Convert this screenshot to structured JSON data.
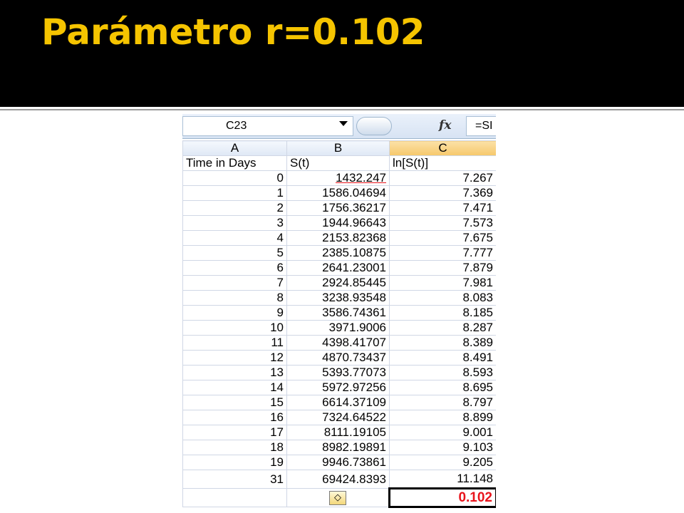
{
  "slide": {
    "title": "Parámetro r=0.102"
  },
  "formula_bar": {
    "name_box": "C23",
    "fx_label": "fx",
    "formula_text": "=SI"
  },
  "columns": [
    "A",
    "B",
    "C"
  ],
  "header_row": {
    "a": "Time in Days",
    "b": "S(t)",
    "c": "ln[S(t)]"
  },
  "rows": [
    {
      "t": "0",
      "s": "1432.247",
      "ln": "7.267"
    },
    {
      "t": "1",
      "s": "1586.04694",
      "ln": "7.369"
    },
    {
      "t": "2",
      "s": "1756.36217",
      "ln": "7.471"
    },
    {
      "t": "3",
      "s": "1944.96643",
      "ln": "7.573"
    },
    {
      "t": "4",
      "s": "2153.82368",
      "ln": "7.675"
    },
    {
      "t": "5",
      "s": "2385.10875",
      "ln": "7.777"
    },
    {
      "t": "6",
      "s": "2641.23001",
      "ln": "7.879"
    },
    {
      "t": "7",
      "s": "2924.85445",
      "ln": "7.981"
    },
    {
      "t": "8",
      "s": "3238.93548",
      "ln": "8.083"
    },
    {
      "t": "9",
      "s": "3586.74361",
      "ln": "8.185"
    },
    {
      "t": "10",
      "s": "3971.9006",
      "ln": "8.287"
    },
    {
      "t": "11",
      "s": "4398.41707",
      "ln": "8.389"
    },
    {
      "t": "12",
      "s": "4870.73437",
      "ln": "8.491"
    },
    {
      "t": "13",
      "s": "5393.77073",
      "ln": "8.593"
    },
    {
      "t": "14",
      "s": "5972.97256",
      "ln": "8.695"
    },
    {
      "t": "15",
      "s": "6614.37109",
      "ln": "8.797"
    },
    {
      "t": "16",
      "s": "7324.64522",
      "ln": "8.899"
    },
    {
      "t": "17",
      "s": "8111.19105",
      "ln": "9.001"
    },
    {
      "t": "18",
      "s": "8982.19891",
      "ln": "9.103"
    },
    {
      "t": "19",
      "s": "9946.73861",
      "ln": "9.205"
    },
    {
      "t": "31",
      "s": "69424.8393",
      "ln": "11.148"
    }
  ],
  "result": {
    "value": "0.102",
    "warning_icon": "warning-icon"
  },
  "colors": {
    "title": "#f5c400",
    "highlight": "#e8141c"
  }
}
